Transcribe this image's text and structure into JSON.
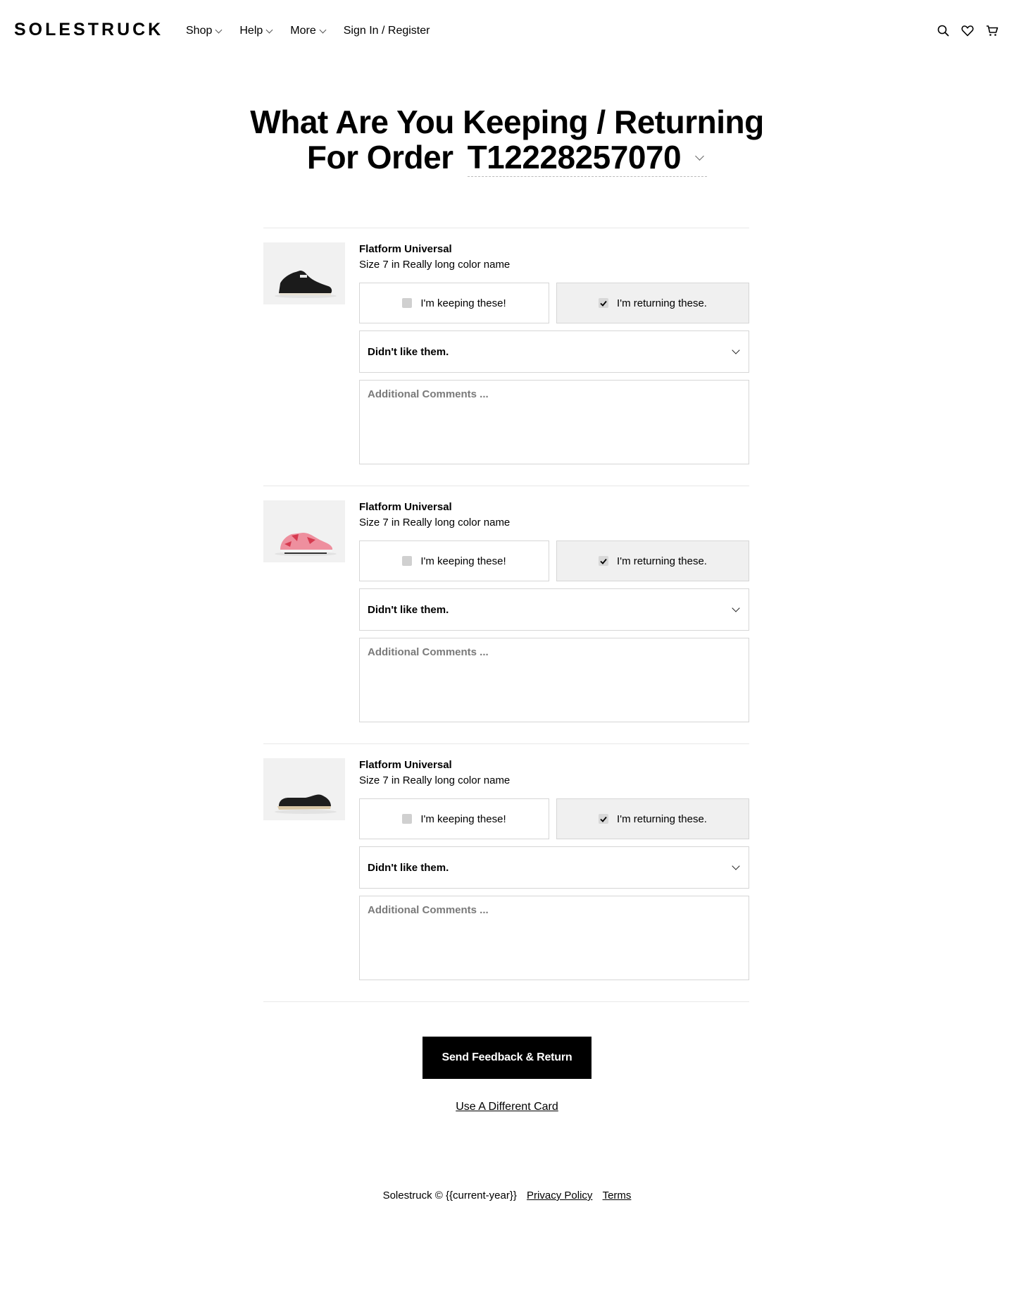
{
  "header": {
    "logo": "SOLESTRUCK",
    "nav": [
      {
        "label": "Shop",
        "has_caret": true
      },
      {
        "label": "Help",
        "has_caret": true
      },
      {
        "label": "More",
        "has_caret": true
      },
      {
        "label": "Sign In / Register",
        "has_caret": false
      }
    ],
    "icons": [
      "search-icon",
      "heart-icon",
      "cart-icon"
    ]
  },
  "page": {
    "title_line1": "What Are You Keeping / Returning",
    "title_line2_prefix": "For Order",
    "order_number": "T12228257070"
  },
  "items": [
    {
      "name": "Flatform Universal",
      "size_text": "Size 7 in Really long color name",
      "keep_label": "I'm keeping these!",
      "return_label": "I'm returning these.",
      "keep_checked": false,
      "return_checked": true,
      "reason": "Didn't like them.",
      "comments_placeholder": "Additional Comments ...",
      "thumb_icon": "sneaker-black-image"
    },
    {
      "name": "Flatform Universal",
      "size_text": "Size 7 in Really long color name",
      "keep_label": "I'm keeping these!",
      "return_label": "I'm returning these.",
      "keep_checked": false,
      "return_checked": true,
      "reason": "Didn't like them.",
      "comments_placeholder": "Additional Comments ...",
      "thumb_icon": "sneaker-pink-image"
    },
    {
      "name": "Flatform Universal",
      "size_text": "Size 7 in Really long color name",
      "keep_label": "I'm keeping these!",
      "return_label": "I'm returning these.",
      "keep_checked": false,
      "return_checked": true,
      "reason": "Didn't like them.",
      "comments_placeholder": "Additional Comments ...",
      "thumb_icon": "slip-on-shoe-image"
    }
  ],
  "actions": {
    "submit_label": "Send Feedback & Return",
    "alt_card_label": "Use A Different Card"
  },
  "footer": {
    "copyright": "Solestruck © {{current-year}}",
    "privacy_label": "Privacy Policy",
    "terms_label": "Terms"
  },
  "colors": {
    "primary": "#000000",
    "border": "#d6d6d6",
    "selected_bg": "#f0f0f0",
    "divider": "#e8e8e8"
  }
}
